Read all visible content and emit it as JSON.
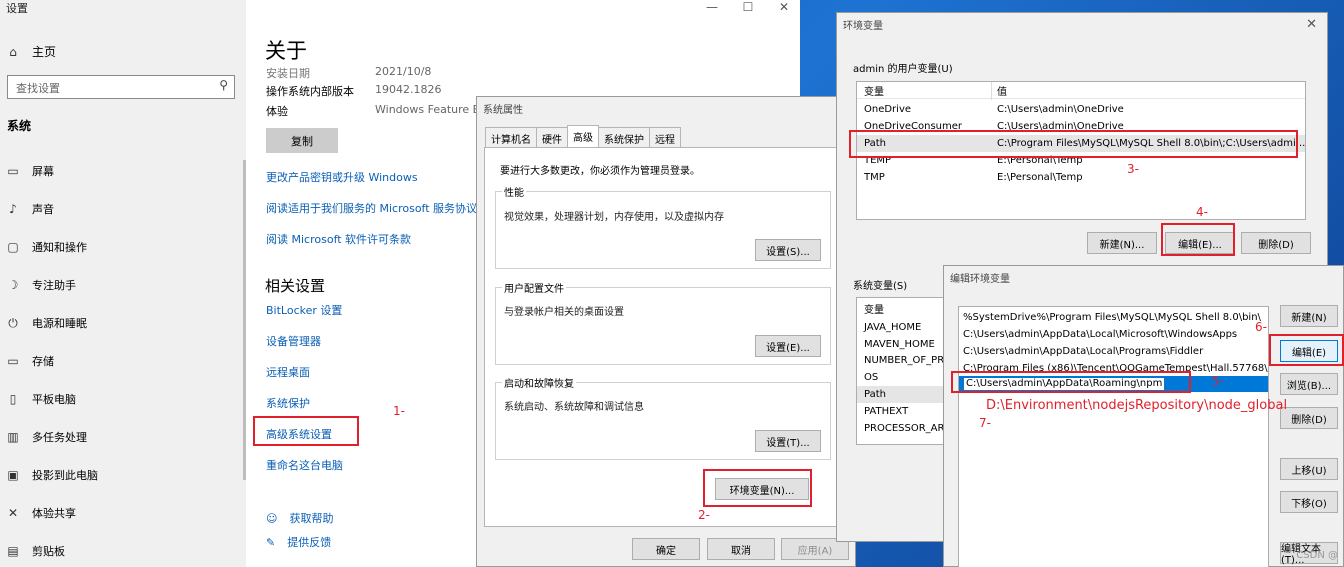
{
  "settings": {
    "title": "设置",
    "win_controls": [
      "—",
      "☐",
      "✕"
    ],
    "home": "主页",
    "search_placeholder": "查找设置",
    "section": "系统",
    "nav": [
      {
        "icon": "display-icon",
        "glyph": "▭",
        "label": "屏幕"
      },
      {
        "icon": "sound-icon",
        "glyph": "♪",
        "label": "声音"
      },
      {
        "icon": "notification-icon",
        "glyph": "▢",
        "label": "通知和操作"
      },
      {
        "icon": "focus-assist-icon",
        "glyph": "☽",
        "label": "专注助手"
      },
      {
        "icon": "power-icon",
        "glyph": "⏻",
        "label": "电源和睡眠"
      },
      {
        "icon": "storage-icon",
        "glyph": "▭",
        "label": "存储"
      },
      {
        "icon": "tablet-icon",
        "glyph": "▯",
        "label": "平板电脑"
      },
      {
        "icon": "multitasking-icon",
        "glyph": "▥",
        "label": "多任务处理"
      },
      {
        "icon": "project-icon",
        "glyph": "▣",
        "label": "投影到此电脑"
      },
      {
        "icon": "shared-experience-icon",
        "glyph": "✕",
        "label": "体验共享"
      },
      {
        "icon": "clipboard-icon",
        "glyph": "▤",
        "label": "剪贴板"
      }
    ],
    "about_title": "关于",
    "specs": [
      {
        "k": "安装日期",
        "v": "2021/10/8"
      },
      {
        "k": "操作系统内部版本",
        "v": "19042.1826"
      },
      {
        "k": "体验",
        "v": "Windows Feature Exp"
      }
    ],
    "copy_btn": "复制",
    "links": [
      "更改产品密钥或升级 Windows",
      "阅读适用于我们服务的 Microsoft 服务协议",
      "阅读 Microsoft 软件许可条款"
    ],
    "related_title": "相关设置",
    "related": [
      "BitLocker 设置",
      "设备管理器",
      "远程桌面",
      "系统保护",
      "高级系统设置",
      "重命名这台电脑"
    ],
    "help": [
      {
        "icon": "help-icon",
        "glyph": "☺",
        "label": "获取帮助"
      },
      {
        "icon": "feedback-icon",
        "glyph": "✎",
        "label": "提供反馈"
      }
    ]
  },
  "sysprop": {
    "title": "系统属性",
    "tabs": [
      "计算机名",
      "硬件",
      "高级",
      "系统保护",
      "远程"
    ],
    "admin_note": "要进行大多数更改，你必须作为管理员登录。",
    "perf": {
      "title": "性能",
      "desc": "视觉效果，处理器计划，内存使用，以及虚拟内存",
      "btn": "设置(S)..."
    },
    "profile": {
      "title": "用户配置文件",
      "desc": "与登录帐户相关的桌面设置",
      "btn": "设置(E)..."
    },
    "startup": {
      "title": "启动和故障恢复",
      "desc": "系统启动、系统故障和调试信息",
      "btn": "设置(T)..."
    },
    "env_btn": "环境变量(N)...",
    "ok": "确定",
    "cancel": "取消",
    "apply": "应用(A)"
  },
  "envvars": {
    "title": "环境变量",
    "user_group": "admin 的用户变量(U)",
    "col_var": "变量",
    "col_val": "值",
    "user_vars": [
      {
        "name": "OneDrive",
        "value": "C:\\Users\\admin\\OneDrive"
      },
      {
        "name": "OneDriveConsumer",
        "value": "C:\\Users\\admin\\OneDrive"
      },
      {
        "name": "Path",
        "value": "C:\\Program Files\\MySQL\\MySQL Shell 8.0\\bin\\;C:\\Users\\admi..."
      },
      {
        "name": "TEMP",
        "value": "E:\\Personal\\Temp"
      },
      {
        "name": "TMP",
        "value": "E:\\Personal\\Temp"
      }
    ],
    "new_btn": "新建(N)...",
    "edit_btn": "编辑(E)...",
    "delete_btn": "删除(D)",
    "sys_group": "系统变量(S)",
    "sys_vars": [
      "JAVA_HOME",
      "MAVEN_HOME",
      "NUMBER_OF_PRO",
      "OS",
      "Path",
      "PATHEXT",
      "PROCESSOR_ARC"
    ]
  },
  "editenv": {
    "title": "编辑环境变量",
    "paths": [
      "%SystemDrive%\\Program Files\\MySQL\\MySQL Shell 8.0\\bin\\",
      "C:\\Users\\admin\\AppData\\Local\\Microsoft\\WindowsApps",
      "C:\\Users\\admin\\AppData\\Local\\Programs\\Fiddler",
      "C:\\Program Files (x86)\\Tencent\\QQGameTempest\\Hall.57768\\"
    ],
    "selected_path": "C:\\Users\\admin\\AppData\\Roaming\\npm",
    "buttons": [
      "新建(N)",
      "编辑(E)",
      "浏览(B)...",
      "删除(D)",
      "上移(U)",
      "下移(O)",
      "编辑文本(T)..."
    ]
  },
  "annotations": {
    "n1": "1-",
    "n2": "2-",
    "n3": "3-",
    "n4": "4-",
    "n5": "5-",
    "n6": "6-",
    "n7": "7-",
    "new_path": "D:\\Environment\\nodejsRepository\\node_global",
    "color": "#e0212b"
  },
  "watermark": "CSDN @"
}
